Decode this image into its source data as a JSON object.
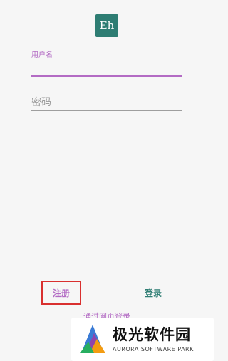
{
  "app": {
    "logo_text": "Eh",
    "accent_color": "#2e7d73",
    "highlight_color": "#b36bc4"
  },
  "form": {
    "username_label": "用户名",
    "username_value": "",
    "password_placeholder": "密码",
    "password_value": ""
  },
  "actions": {
    "register_label": "注册",
    "login_label": "登录",
    "web_login_label": "通过网页登录"
  },
  "watermark": {
    "brand_cn": "极光软件园",
    "brand_en": "AURORA SOFTWARE PARK"
  }
}
